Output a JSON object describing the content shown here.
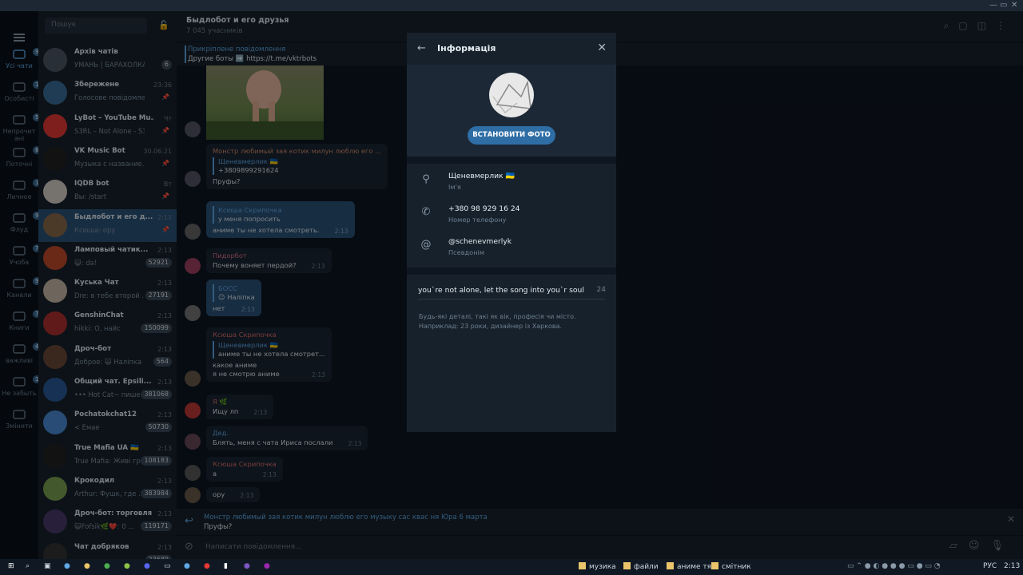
{
  "app": {
    "colors": {
      "accent": "#5fa8e6",
      "bg": "#0e1621",
      "panel": "#17212b",
      "selected": "#2b5278"
    }
  },
  "folders": [
    {
      "label": "Усі чати",
      "badge": "99+",
      "icon": "chat-bubbles-icon"
    },
    {
      "label": "Особисті",
      "badge": "10",
      "icon": "person-icon"
    },
    {
      "label": "Непрочит ані",
      "badge": "5",
      "icon": "bell-icon"
    },
    {
      "label": "Поточні",
      "badge": "6",
      "icon": "message-icon"
    },
    {
      "label": "Личное",
      "badge": "1",
      "icon": "home-icon"
    },
    {
      "label": "Флуд",
      "badge": "99+",
      "icon": "people-icon"
    },
    {
      "label": "Учоба",
      "badge": "7",
      "icon": "graduation-icon"
    },
    {
      "label": "Канали",
      "badge": "99+",
      "icon": "megaphone-icon"
    },
    {
      "label": "Книги",
      "badge": "7",
      "icon": "list-icon"
    },
    {
      "label": "важливі",
      "badge": "4",
      "icon": "star-icon"
    },
    {
      "label": "Не забыть",
      "badge": "1",
      "icon": "inbox-icon"
    },
    {
      "label": "Змінити",
      "badge": "",
      "icon": "sliders-icon"
    }
  ],
  "chatlist": {
    "search_placeholder": "Пошук",
    "chats": [
      {
        "name": "Архів чатів",
        "time": "",
        "preview": "УМАНЬ | БАРАХОЛКА ...",
        "badge": "6",
        "pinned": false
      },
      {
        "name": "Збережене",
        "time": "23:36",
        "preview": "Голосове повідомлення",
        "badge": "",
        "pinned": true
      },
      {
        "name": "LyBot – YouTube Mu...",
        "time": "Чт",
        "preview": "S3RL – Not Alone - S3RL f...",
        "badge": "",
        "pinned": true
      },
      {
        "name": "VK Music Bot",
        "time": "30.06.21",
        "preview": "Музыка с названиe...",
        "badge": "",
        "pinned": true
      },
      {
        "name": "IQDB bot",
        "time": "Вт",
        "preview": "Вы: /start",
        "badge": "",
        "pinned": true
      },
      {
        "name": "Быдлобот и его д...",
        "time": "2:13",
        "preview": "Ксюша: ору",
        "badge": "",
        "pinned": true
      },
      {
        "name": "Ламповый чатик...",
        "time": "2:13",
        "preview": "😺: da!",
        "badge": "52921",
        "pinned": false
      },
      {
        "name": "Куська Чат",
        "time": "2:13",
        "preview": "Dre: в тебе второй ...",
        "badge": "27191",
        "pinned": false
      },
      {
        "name": "GenshinChat",
        "time": "2:13",
        "preview": "hikki: О, найс",
        "badge": "150099",
        "pinned": false
      },
      {
        "name": "Дроч-бот",
        "time": "2:13",
        "preview": "Доброе: 🙀 Наліпка",
        "badge": "564",
        "pinned": false
      },
      {
        "name": "Общий чат. Epsili...",
        "time": "2:13",
        "preview": "••• Hot Cat~ пише",
        "badge": "381068",
        "pinned": false
      },
      {
        "name": "Pochatokchat12",
        "time": "2:13",
        "preview": "< Емае",
        "badge": "50730",
        "pinned": false
      },
      {
        "name": "True Mafia UA 🇺🇦",
        "time": "2:13",
        "preview": "True Mafia: Живі гр...",
        "badge": "108183",
        "pinned": false
      },
      {
        "name": "Крокодил",
        "time": "2:13",
        "preview": "Arthur: Фушк, где ...",
        "badge": "383984",
        "pinned": false
      },
      {
        "name": "Дроч-бот: торговля",
        "time": "2:13",
        "preview": "😺Fofsik🌿❤️: 0 ...",
        "badge": "119171",
        "pinned": false
      },
      {
        "name": "Чат добряков",
        "time": "2:13",
        "preview": "",
        "badge": "23689",
        "pinned": false
      }
    ]
  },
  "chat": {
    "title": "Быдлобот и его друзья",
    "subtitle": "7 045 учасників",
    "pinned_label": "Прикріплене повідомлення",
    "pinned_text": "Другие боты ➡️ https://t.me/vktrbots",
    "messages": [
      {
        "sender": "Монстр любимый зая котик милун люблю его ...",
        "quote_name": "Щеневмерлик 🇺🇦",
        "quote_text": "+3809899291624",
        "text": "Пруфы?",
        "time": "",
        "out": false,
        "color": "#d88a6a"
      },
      {
        "sender": "",
        "quote_name": "Ксюша Скрипочка",
        "quote_text": "у меня попросить",
        "text": "аниме ты не хотела смотреть.",
        "time": "2:13",
        "out": true,
        "color": ""
      },
      {
        "sender": "Пидорбот",
        "quote_name": "",
        "quote_text": "",
        "text": "Почему воняет пердой?",
        "time": "2:13",
        "out": false,
        "color": "#e0728c"
      },
      {
        "sender": "",
        "quote_name": "БОСС",
        "quote_text": "😐 Наліпка",
        "text": "нет",
        "time": "2:13",
        "out": true,
        "color": ""
      },
      {
        "sender": "Ксюша Скрипочка",
        "quote_name": "Щеневмерлик 🇺🇦",
        "quote_text": "аниме ты не хотела смотрет...",
        "text": "какое аниме\nя не смотрю аниме",
        "time": "2:13",
        "out": false,
        "color": "#e06e6e"
      },
      {
        "sender": "Я 🌿",
        "quote_name": "",
        "quote_text": "",
        "text": "Ищу лп",
        "time": "2:13",
        "out": false,
        "color": "#e06e6e"
      },
      {
        "sender": "Дед.",
        "quote_name": "",
        "quote_text": "",
        "text": "Блять, меня с чата Ириса послали",
        "time": "2:13",
        "out": false,
        "color": "#5fa8e6"
      },
      {
        "sender": "Ксюша Скрипочка",
        "quote_name": "",
        "quote_text": "",
        "text": "а",
        "time": "2:13",
        "out": false,
        "color": "#e06e6e"
      },
      {
        "sender": "",
        "quote_name": "",
        "quote_text": "",
        "text": "ору",
        "time": "2:13",
        "out": false,
        "color": ""
      }
    ],
    "reply_name": "Монстр любимый зая котик милун люблю его музыку сас квас ня Юра 6 марта",
    "reply_text": "Пруфы?",
    "composer_placeholder": "Написати повідомлення..."
  },
  "info": {
    "title": "Інформація",
    "set_photo": "ВСТАНОВИТИ ФОТО",
    "name_value": "Щеневмерлик 🇺🇦",
    "name_label": "Ім'я",
    "phone_value": "+380 98 929 16 24",
    "phone_label": "Номер телефону",
    "username_value": "@schenevmerlyk",
    "username_label": "Псевдонім",
    "bio": "you`re not alone, let the song into you`r soul",
    "bio_count": "24",
    "hint": "Будь-які деталі, такі як вік, професія чи місто. Наприклад: 23 роки, дизайнер із Харкова."
  },
  "taskbar": {
    "folders": [
      "музика",
      "файли",
      "аниме тян",
      "смітник"
    ],
    "lang": "РУС",
    "time": "2:13"
  }
}
